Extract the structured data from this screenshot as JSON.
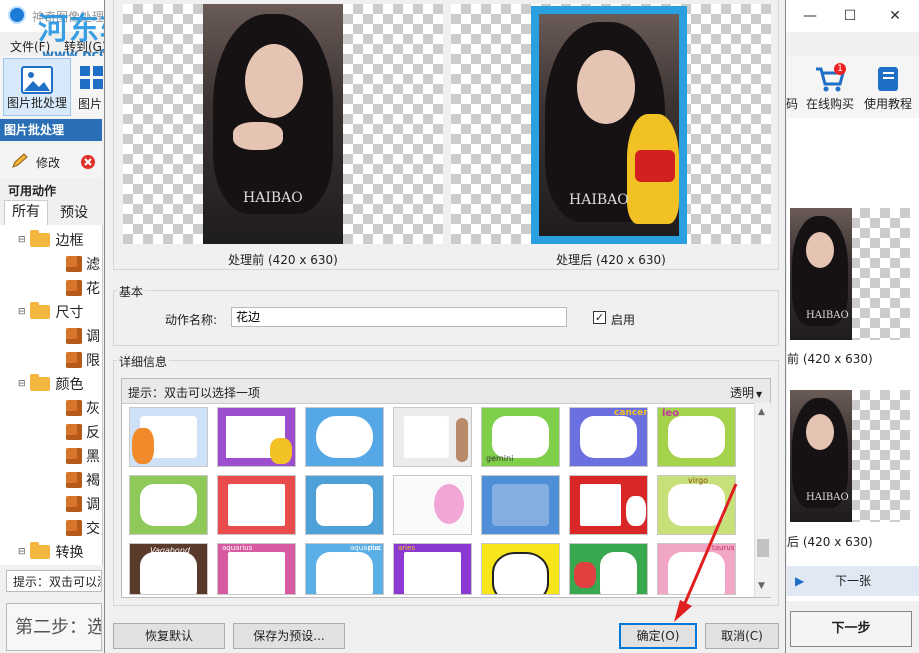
{
  "main_window": {
    "title": "神奇图像处理",
    "watermark_text": "河东软件园",
    "watermark_url": "www.pc0359.cn",
    "menu": [
      "文件(F)",
      "转到(G)"
    ],
    "toolbar_left": [
      {
        "label": "图片批处理",
        "icon": "image-icon"
      },
      {
        "label": "图片",
        "icon": "grid-icon"
      }
    ],
    "toolbar_right": [
      {
        "label": "码",
        "icon": "qr-icon"
      },
      {
        "label": "在线购买",
        "icon": "cart-icon",
        "badge": "1"
      },
      {
        "label": "使用教程",
        "icon": "book-icon"
      }
    ],
    "section_title": "图片批处理",
    "edit_label": "修改",
    "actions_title": "可用动作",
    "tabs": [
      "所有",
      "预设"
    ],
    "tree": [
      {
        "type": "folder",
        "label": "边框"
      },
      {
        "type": "item",
        "label": "滤"
      },
      {
        "type": "item",
        "label": "花"
      },
      {
        "type": "folder",
        "label": "尺寸"
      },
      {
        "type": "item",
        "label": "调"
      },
      {
        "type": "item",
        "label": "限"
      },
      {
        "type": "folder",
        "label": "颜色"
      },
      {
        "type": "item",
        "label": "灰"
      },
      {
        "type": "item",
        "label": "反"
      },
      {
        "type": "item",
        "label": "黑"
      },
      {
        "type": "item",
        "label": "褐"
      },
      {
        "type": "item",
        "label": "调"
      },
      {
        "type": "item",
        "label": "交"
      },
      {
        "type": "folder",
        "label": "转换"
      }
    ],
    "hint": "提示：双击可以添",
    "step_text": "第二步：选",
    "right_captions": [
      "前 (420 x 630)",
      "后 (420 x 630)"
    ],
    "right_photo_text": "HAIBAO",
    "next_label": "下一张",
    "next_step_label": "下一步"
  },
  "dialog": {
    "preview": {
      "before_caption": "处理前 (420 x 630)",
      "after_caption": "处理后 (420 x 630)",
      "photo_text": "HAIBAO"
    },
    "basic": {
      "title": "基本",
      "name_label": "动作名称:",
      "name_value": "花边",
      "enable_label": "启用",
      "enabled": true
    },
    "details": {
      "title": "详细信息",
      "hint": "提示：双击可以选择一项",
      "dropdown": "透明",
      "thumb_texts": [
        "gemini",
        "cancer",
        "leo",
        "virgo",
        "Vagabond",
        "aquarius",
        "aquarius",
        "pisc",
        "aries",
        "taurus"
      ]
    },
    "buttons": {
      "restore": "恢复默认",
      "save_preset": "保存为预设...",
      "ok": "确定(O)",
      "cancel": "取消(C)"
    }
  },
  "colors": {
    "accent_blue": "#2a6fb6",
    "arrow_red": "#e02020",
    "frame_blue": "#2aa0e0"
  }
}
